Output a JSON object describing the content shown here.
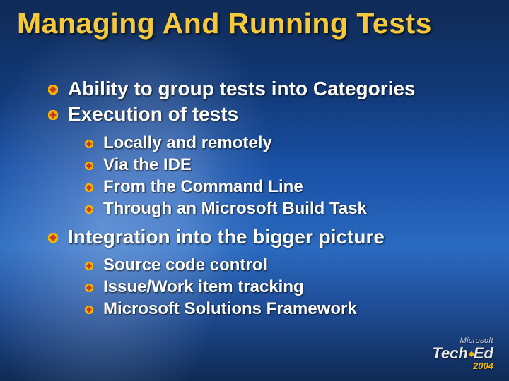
{
  "title": "Managing And Running Tests",
  "bullets_lvl1": [
    "Ability to group tests into Categories",
    "Execution of tests"
  ],
  "bullets_lvl2_a": [
    "Locally and remotely",
    "Via the IDE",
    "From the Command Line",
    "Through an Microsoft Build Task"
  ],
  "bullets_lvl1_b": [
    "Integration into the bigger picture"
  ],
  "bullets_lvl2_b": [
    "Source code control",
    "Issue/Work item tracking",
    "Microsoft Solutions Framework"
  ],
  "footer": {
    "brand": "Microsoft",
    "main": "Tech·Ed",
    "year": "2004"
  }
}
